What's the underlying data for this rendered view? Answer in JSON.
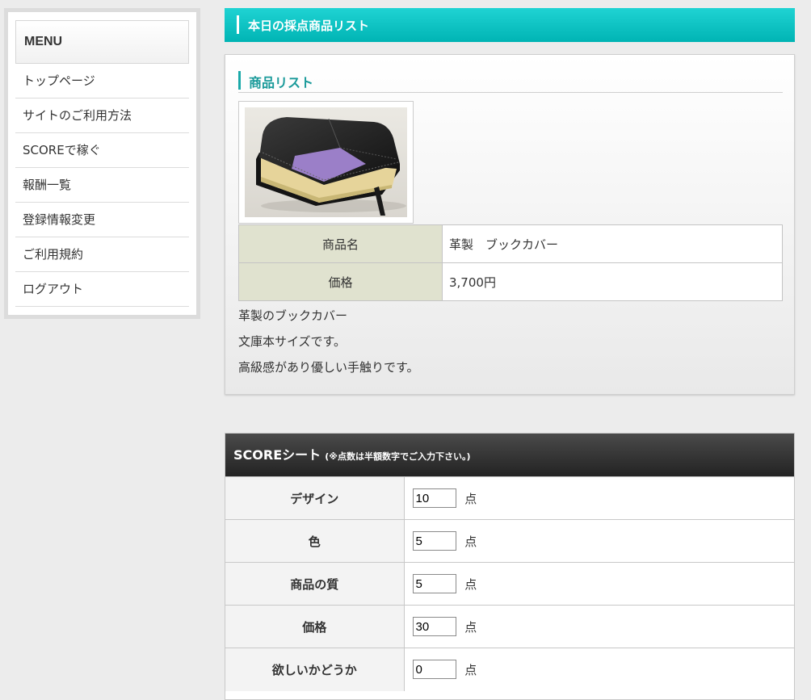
{
  "sidebar": {
    "menu_title": "MENU",
    "items": [
      {
        "label": "トップページ"
      },
      {
        "label": "サイトのご利用方法"
      },
      {
        "label": "SCOREで稼ぐ"
      },
      {
        "label": "報酬一覧"
      },
      {
        "label": "登録情報変更"
      },
      {
        "label": "ご利用規約"
      },
      {
        "label": "ログアウト"
      }
    ]
  },
  "page": {
    "title": "本日の採点商品リスト"
  },
  "product": {
    "section_title": "商品リスト",
    "image_icon": "book-cover-photo",
    "name_label": "商品名",
    "name_value": "革製　ブックカバー",
    "price_label": "価格",
    "price_value": "3,700円",
    "description": [
      "革製のブックカバー",
      "文庫本サイズです。",
      "高級感があり優しい手触りです。"
    ]
  },
  "score_sheet": {
    "title": "SCOREシート",
    "note": "(※点数は半額数字でご入力下さい。)",
    "unit": "点",
    "rows": [
      {
        "label": "デザイン",
        "value": "10"
      },
      {
        "label": "色",
        "value": "5"
      },
      {
        "label": "商品の質",
        "value": "5"
      },
      {
        "label": "価格",
        "value": "30"
      },
      {
        "label": "欲しいかどうか",
        "value": "0"
      }
    ]
  },
  "colors": {
    "accent": "#00b4b4",
    "accent_dark": "#1a9a9a",
    "table_label_bg": "#e0e2cf",
    "score_header_bg": "#2e2e2e"
  }
}
